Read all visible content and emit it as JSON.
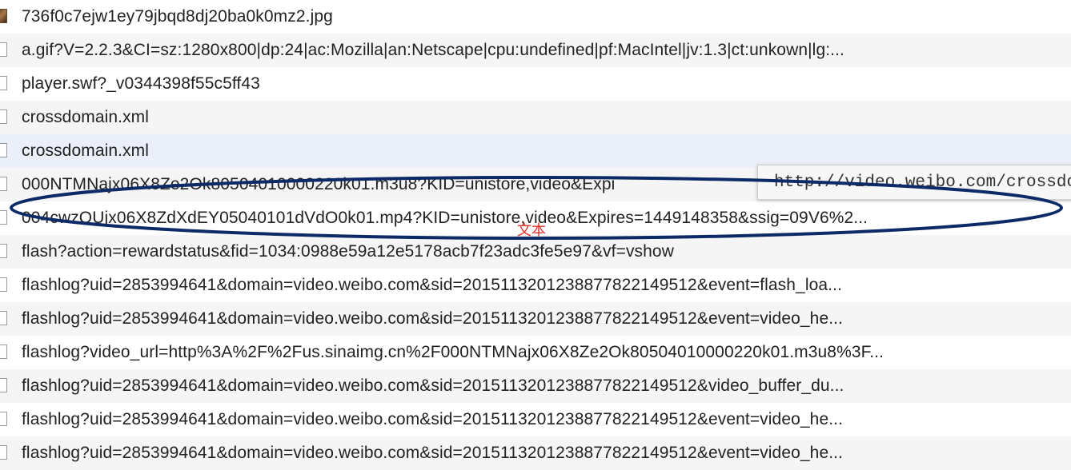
{
  "requests": [
    {
      "name": "736f0c7ejw1ey79jbqd8dj20ba0k0mz2.jpg",
      "icon": "image-file-icon"
    },
    {
      "name": "a.gif?V=2.2.3&CI=sz:1280x800|dp:24|ac:Mozilla|an:Netscape|cpu:undefined|pf:MacIntel|jv:1.3|ct:unkown|lg:...",
      "icon": "document-icon"
    },
    {
      "name": "player.swf?_v0344398f55c5ff43",
      "icon": "document-icon"
    },
    {
      "name": "crossdomain.xml",
      "icon": "document-icon"
    },
    {
      "name": "crossdomain.xml",
      "icon": "document-icon",
      "selected": true
    },
    {
      "name": "000NTMNajx06X8Ze2Ok80504010000220k01.m3u8?KID=unistore,video&Expi",
      "icon": "document-icon"
    },
    {
      "name": "004cwzOUjx06X8ZdXdEY05040101dVdO0k01.mp4?KID=unistore,video&Expires=1449148358&ssig=09V6%2...",
      "icon": "document-icon"
    },
    {
      "name": "flash?action=rewardstatus&fid=1034:0988e59a12e5178acb7f23adc3fe5e97&vf=vshow",
      "icon": "document-icon"
    },
    {
      "name": "flashlog?uid=2853994641&domain=video.weibo.com&sid=2015113201238877822149512&event=flash_loa...",
      "icon": "document-icon"
    },
    {
      "name": "flashlog?uid=2853994641&domain=video.weibo.com&sid=2015113201238877822149512&event=video_he...",
      "icon": "document-icon"
    },
    {
      "name": "flashlog?video_url=http%3A%2F%2Fus.sinaimg.cn%2F000NTMNajx06X8Ze2Ok80504010000220k01.m3u8%3F...",
      "icon": "document-icon"
    },
    {
      "name": "flashlog?uid=2853994641&domain=video.weibo.com&sid=2015113201238877822149512&video_buffer_du...",
      "icon": "document-icon"
    },
    {
      "name": "flashlog?uid=2853994641&domain=video.weibo.com&sid=2015113201238877822149512&event=video_he...",
      "icon": "document-icon"
    },
    {
      "name": "flashlog?uid=2853994641&domain=video.weibo.com&sid=2015113201238877822149512&event=video_he...",
      "icon": "document-icon"
    }
  ],
  "tooltip": {
    "text": "http://video.weibo.com/crossdo"
  },
  "annotation": {
    "label": "文本",
    "stroke_color": "#0b2a66",
    "label_color": "#e0322b"
  },
  "colors": {
    "row_alt": "#f5f5f5",
    "row_selected": "#ebeff9",
    "text": "#222222"
  }
}
